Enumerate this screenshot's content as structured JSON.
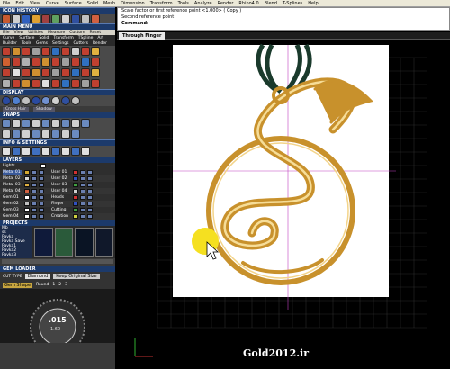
{
  "menubar": [
    "File",
    "Edit",
    "View",
    "Curve",
    "Surface",
    "Solid",
    "Mesh",
    "Dimension",
    "Transform",
    "Tools",
    "Analyze",
    "Render",
    "Rhino4.0",
    "Blend",
    "T-Splines",
    "Help"
  ],
  "left": {
    "icon_history_title": "ICON HISTORY",
    "main_menu_title": "MAIN MENU",
    "main_menu_tabs": [
      "File",
      "View",
      "Utilities",
      "Measure",
      "Custom",
      "Reset"
    ],
    "main_menu_groups": [
      "Curve",
      "Surface",
      "Solid",
      "Transform",
      "TSpline",
      "Art"
    ],
    "main_menu_groups2": [
      "Builder",
      "Tools",
      "Gems",
      "Settings",
      "Cutters",
      "Render"
    ],
    "display_title": "DISPLAY",
    "display_labels": [
      "Cross Hair",
      "Shadow"
    ],
    "snaps_title": "SNAPS",
    "info_title": "INFO & SETTINGS",
    "layers_title": "LAYERS",
    "lights_label": "Lights",
    "layers_left": [
      "Metal 01",
      "Metal 02",
      "Metal 03",
      "Metal 04",
      "Gem 01",
      "Gem 02",
      "Gem 03",
      "Gem 04"
    ],
    "layers_right": [
      "User 01",
      "User 02",
      "User 03",
      "User 04",
      "Heads",
      "Finger",
      "Cutting",
      "Creation"
    ],
    "projects_title": "PROJECTS",
    "projects_list": [
      "Mb",
      "ss",
      "Pavka",
      "Pavka Save",
      "Pavka1",
      "Pavka2",
      "Pavka3"
    ],
    "gem_loader_title": "GEM LOADER",
    "cut_type_label": "CUT TYPE",
    "cut_type_value": "Diamond",
    "keep_size_label": "Keep Original Size",
    "gem_shape_label": "Gem Shape",
    "gem_shape_value": "Round",
    "gem_numbers": [
      "1",
      "2",
      "3"
    ],
    "dial_value": ".015",
    "dial_sub": "1.60"
  },
  "command": {
    "line1": "Scale factor or first reference point <1.000> ( Copy )",
    "line2": "Second reference point",
    "prompt": "Command:"
  },
  "viewport": {
    "tab": "Through Finger",
    "watermark": "Gold2012.ir"
  },
  "colors": {
    "panel_header": "#1c3a6b",
    "pendant_gold": "#c8912c",
    "cord": "#1a3a2c",
    "cursor_highlight": "#f5e020",
    "crosshair": "#c040c0"
  }
}
